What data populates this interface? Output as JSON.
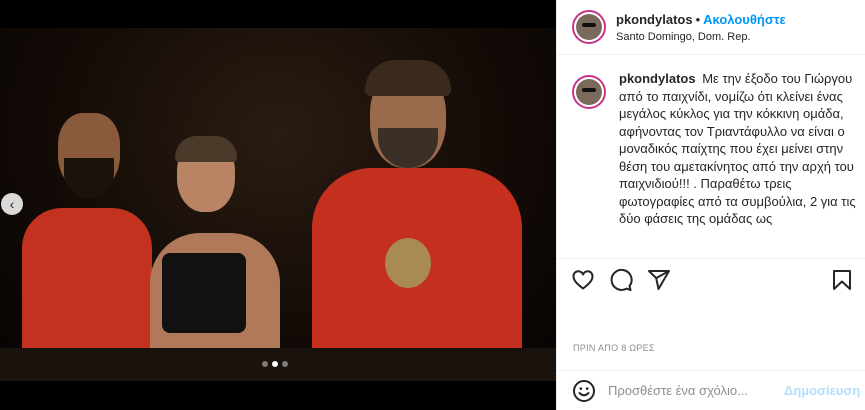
{
  "post": {
    "username": "pkondylatos",
    "separator": "•",
    "follow_label": "Ακολουθήστε",
    "location": "Santo Domingo, Dom. Rep.",
    "caption": "Με την έξοδο του Γιώργου από το παιχνίδι, νομίζω ότι κλείνει ένας μεγάλος κύκλος για την κόκκινη ομάδα, αφήνοντας τον Τριαντάφυλλο να είναι ο μοναδικός παίχτης που έχει μείνει στην θέση του αμετακίνητος από την αρχή του παιχνιδιού!!! . Παραθέτω τρεις φωτογραφίες από τα συμβούλια, 2 για τις δύο φάσεις της ομάδας ως",
    "timestamp": "ΠΡΙΝ ΑΠΟ 8 ΩΡΕΣ"
  },
  "media": {
    "carousel_total": 3,
    "carousel_active": 2
  },
  "actions": {
    "like_icon": "heart-icon",
    "comment_icon": "comment-icon",
    "share_icon": "share-icon",
    "save_icon": "bookmark-icon"
  },
  "comment": {
    "placeholder": "Προσθέστε ένα σχόλιο...",
    "post_label": "Δημοσίευση"
  },
  "colors": {
    "accent": "#0095f6",
    "post_disabled": "#b2dffc",
    "avatar_ring": "#c8338a"
  }
}
